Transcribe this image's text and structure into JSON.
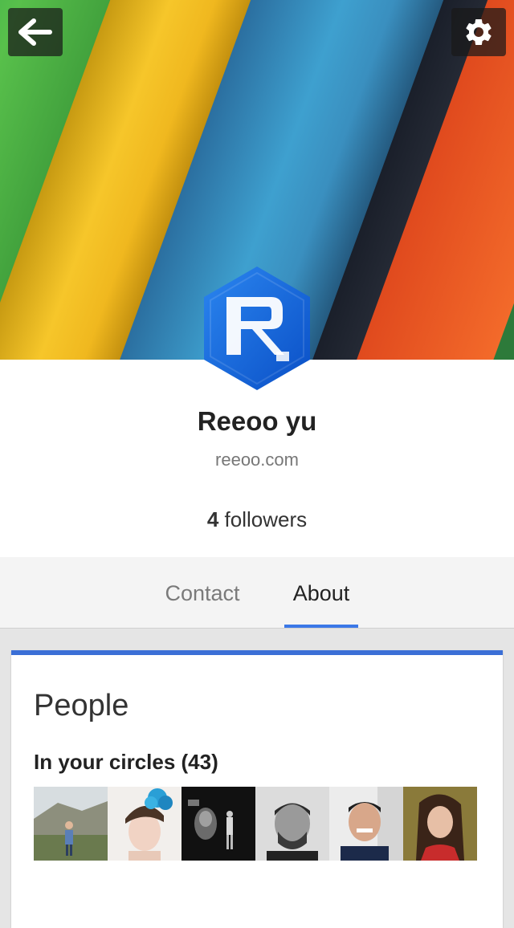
{
  "header": {
    "back_icon": "arrow-left-icon",
    "settings_icon": "gear-icon",
    "avatar_icon": "reeoo-logo-icon",
    "colors": {
      "green": "#4caf50",
      "yellow": "#f6c62a",
      "blue": "#3ea0cf",
      "orange": "#f36a2a",
      "avatar_blue": "#1a73e8"
    }
  },
  "profile": {
    "name": "Reeoo yu",
    "site": "reeoo.com",
    "followers_count": "4",
    "followers_label": "followers"
  },
  "tabs": [
    {
      "label": "Contact",
      "active": false
    },
    {
      "label": "About",
      "active": true
    }
  ],
  "accent_color": "#3b78e7",
  "people": {
    "title": "People",
    "circles_label": "In your circles (43)",
    "thumbnails": [
      {
        "icon": "person-photo-outdoor"
      },
      {
        "icon": "person-photo-flower-hat"
      },
      {
        "icon": "person-photo-stage"
      },
      {
        "icon": "person-photo-bw-man"
      },
      {
        "icon": "person-photo-smiling-man"
      },
      {
        "icon": "person-photo-woman"
      }
    ]
  }
}
